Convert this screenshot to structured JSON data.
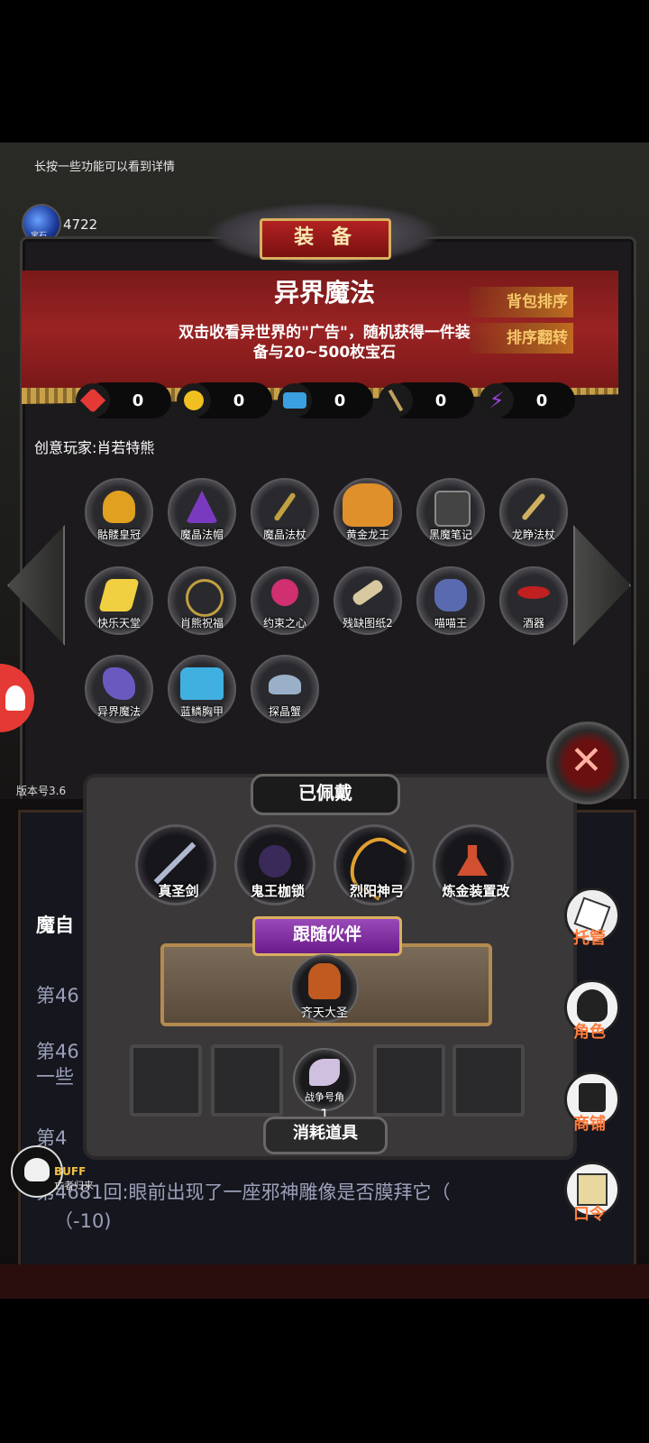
{
  "hint": "长按一些功能可以看到详情",
  "gems": {
    "count": "4722",
    "label": "宝石"
  },
  "panel": {
    "title": "装 备",
    "item_name": "异界魔法",
    "item_desc_line1": "双击收看异世界的\"广告\"，随机获得一件装",
    "item_desc_line2": "备与20~500枚宝石",
    "btn_sort": "背包排序",
    "btn_flip": "排序翻转",
    "stats": [
      {
        "icon": "heart-icon",
        "value": "0",
        "color": "#e53935"
      },
      {
        "icon": "strength-icon",
        "value": "0",
        "color": "#f0c020"
      },
      {
        "icon": "armor-icon",
        "value": "0",
        "color": "#3aa0e0"
      },
      {
        "icon": "sword-icon",
        "value": "0",
        "color": "#c0a060"
      },
      {
        "icon": "lightning-icon",
        "value": "0",
        "color": "#a040e0"
      }
    ],
    "player": "创意玩家:肖若特熊",
    "items": [
      {
        "label": "骷髅皇冠",
        "color": "#e0a020"
      },
      {
        "label": "魔晶法帽",
        "color": "#7a3ac0"
      },
      {
        "label": "魔晶法杖",
        "color": "#c0a040"
      },
      {
        "label": "黄金龙王",
        "color": "#e0902a"
      },
      {
        "label": "黑魔笔记",
        "color": "#555555"
      },
      {
        "label": "龙睁法杖",
        "color": "#d0b060"
      },
      {
        "label": "快乐天堂",
        "color": "#f0d040"
      },
      {
        "label": "肖熊祝福",
        "color": "#40a040"
      },
      {
        "label": "约束之心",
        "color": "#d03070"
      },
      {
        "label": "残缺图纸2",
        "color": "#d8c8a0"
      },
      {
        "label": "喵喵王",
        "color": "#5a6ab0"
      },
      {
        "label": "酒器",
        "color": "#c02020"
      },
      {
        "label": "异界魔法",
        "color": "#6a5ac0"
      },
      {
        "label": "蓝鳞胸甲",
        "color": "#40b0e0"
      },
      {
        "label": "探晶蟹",
        "color": "#9ab0c8"
      }
    ]
  },
  "version": "版本号3.6",
  "equipped": {
    "title": "已佩戴",
    "items": [
      {
        "label": "真圣剑",
        "color": "#b0b8d0"
      },
      {
        "label": "鬼王枷锁",
        "color": "#5a3a8a"
      },
      {
        "label": "烈阳神弓",
        "color": "#e0a030"
      },
      {
        "label": "炼金装置改",
        "color": "#d05030"
      }
    ]
  },
  "companion": {
    "title": "跟随伙伴",
    "name": "齐天大圣"
  },
  "consumables": {
    "title": "消耗道具",
    "item": "战争号角",
    "count": "1"
  },
  "log": {
    "l1": "魔自",
    "l2": "第46",
    "l3": "第46",
    "l3b": "一些",
    "l4": "第4",
    "l5": "第4681回:眼前出现了一座邪神雕像是否膜拜它（",
    "l5b": "（-10)"
  },
  "right_menu": [
    "托管",
    "角色",
    "商铺",
    "口令"
  ],
  "buff": {
    "label": "BUFF",
    "name": "亡者归来"
  }
}
